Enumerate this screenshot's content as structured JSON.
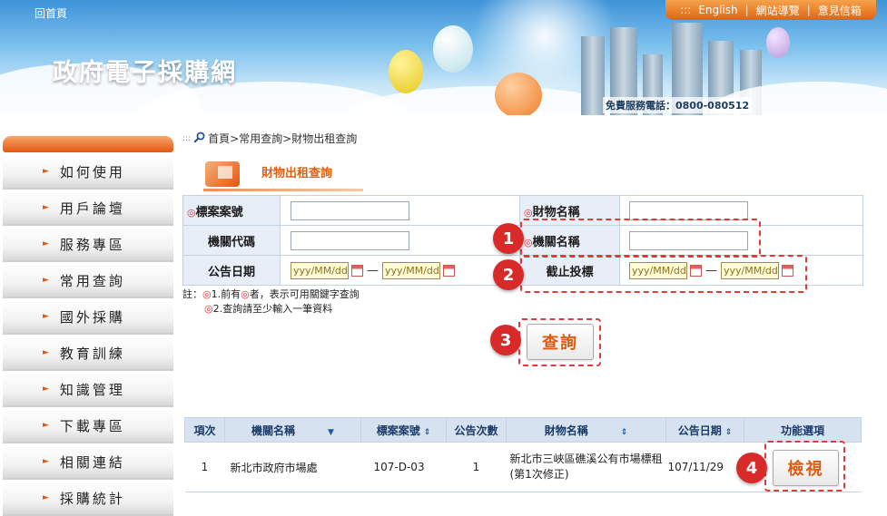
{
  "header": {
    "home_link": "回首頁",
    "site_title": "政府電子採購網",
    "nav": [
      "English",
      "網站導覽",
      "意見信箱"
    ],
    "hotline": "免費服務電話：0800-080512"
  },
  "sidebar": {
    "items": [
      {
        "label": "如何使用"
      },
      {
        "label": "用戶論壇"
      },
      {
        "label": "服務專區"
      },
      {
        "label": "常用查詢"
      },
      {
        "label": "國外採購"
      },
      {
        "label": "教育訓練"
      },
      {
        "label": "知識管理"
      },
      {
        "label": "下載專區"
      },
      {
        "label": "相關連結"
      },
      {
        "label": "採購統計"
      }
    ]
  },
  "breadcrumb": "首頁>常用查詢>財物出租查詢",
  "section_title": "財物出租查詢",
  "form": {
    "case_no_label": "標案案號",
    "asset_name_label": "財物名稱",
    "agency_code_label": "機關代碼",
    "agency_name_label": "機關名稱",
    "announce_date_label": "公告日期",
    "deadline_label": "截止投標",
    "date_placeholder": "yyy/MM/dd",
    "dash": "—"
  },
  "notes": {
    "prefix": "註：",
    "line1": "1.前有",
    "line1b": "者，表示可用關鍵字查詢",
    "line2": "2.查詢請至少輸入一筆資料"
  },
  "search_button": "查詢",
  "results": {
    "headers": [
      "項次",
      "機關名稱",
      "標案案號",
      "公告次數",
      "財物名稱",
      "公告日期",
      "功能選項"
    ],
    "rows": [
      {
        "index": "1",
        "agency": "新北市政府市場處",
        "case_no": "107-D-03",
        "count": "1",
        "asset": "新北市三峽區礁溪公有市場標租(第1次修正)",
        "date": "107/11/29",
        "action": "檢視"
      }
    ]
  },
  "badges": [
    "1",
    "2",
    "3",
    "4"
  ],
  "colors": {
    "accent": "#e05a10",
    "highlight": "#d92a2a",
    "header_bg": "#d6e2ef"
  }
}
